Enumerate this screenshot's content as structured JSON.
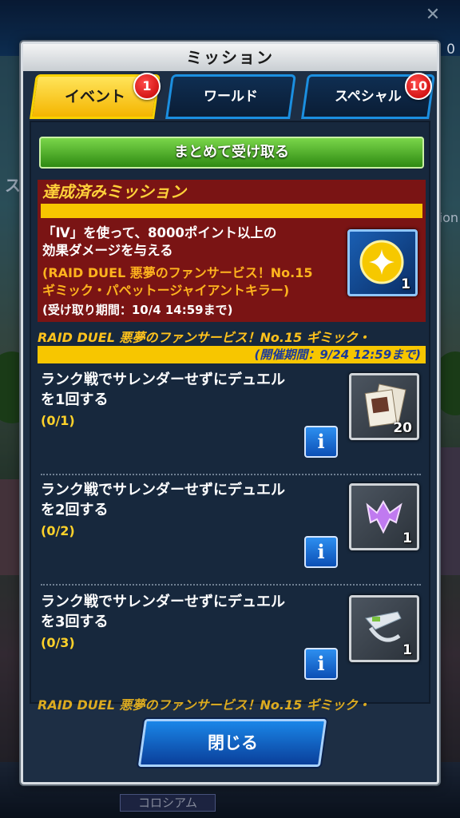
{
  "window": {
    "title": "ミッション"
  },
  "tabs": [
    {
      "label": "イベント",
      "badge": "1",
      "active": true
    },
    {
      "label": "ワールド",
      "badge": "",
      "active": false
    },
    {
      "label": "スペシャル",
      "badge": "10",
      "active": false
    }
  ],
  "receive_all_label": "まとめて受け取る",
  "completed": {
    "header": "達成済みミッション",
    "mission": {
      "line1": "「Ⅳ」を使って、8000ポイント以上の",
      "line2": "効果ダメージを与える",
      "event_line1": "(RAID DUEL 悪夢のファンサービス！No.15",
      "event_line2": "ギミック・パペットージャイアントキラー)",
      "period": "(受け取り期間：10/4 14:59まで)",
      "reward_icon": "gem-icon",
      "reward_count": "1"
    }
  },
  "event": {
    "banner": "RAID DUEL 悪夢のファンサービス！No.15 ギミック・",
    "period": "(開催期間：9/24 12:59まで)"
  },
  "missions": [
    {
      "title_line1": "ランク戦でサレンダーせずにデュエル",
      "title_line2": "を1回する",
      "progress": "(0/1)",
      "reward_icon": "card-pack-icon",
      "reward_count": "20"
    },
    {
      "title_line1": "ランク戦でサレンダーせずにデュエル",
      "title_line2": "を2回する",
      "progress": "(0/2)",
      "reward_icon": "purple-emblem-icon",
      "reward_count": "1"
    },
    {
      "title_line1": "ランク戦でサレンダーせずにデュエル",
      "title_line2": "を3回する",
      "progress": "(0/3)",
      "reward_icon": "duel-disk-icon",
      "reward_count": "1"
    }
  ],
  "event_footer_banner": "RAID DUEL 悪夢のファンサービス！No.15 ギミック・",
  "info_label": "i",
  "close_label": "閉じる",
  "background": {
    "top_right_number": "0",
    "side_text_left": "ス",
    "side_text_right": "ion",
    "bottom_nav_label": "コロシアム"
  },
  "colors": {
    "accent_yellow": "#f7c600",
    "completed_bg": "#7a1414",
    "panel_bg": "#17283d",
    "tab_border": "#1b8fe0",
    "green_button": "#2e8a12"
  }
}
